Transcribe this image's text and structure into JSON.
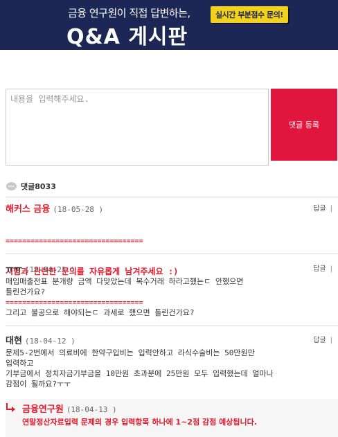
{
  "banner": {
    "subtitle": "금융 연구원이 직접 답변하는,",
    "title": "Q&A 게시판",
    "badge": "실시간 부분점수 문의!"
  },
  "form": {
    "placeholder": "내용을 입력해주세요.",
    "submit_label": "댓글 등록"
  },
  "comment_count_label": "댓글8033",
  "reply_label": "답글",
  "reply_separator": "|",
  "comments": [
    {
      "author": "해커스 금융",
      "date": "(18-05-28 )",
      "lines": [
        "=================================",
        "시험과 관련한 문의를 자유롭게 남겨주세요 :)",
        "================================="
      ]
    },
    {
      "author": "ㅠㅠ",
      "date": "(18-04-21 )",
      "body": "매입매출전표 분개량 금액 다맞았는데 복수거래 하라고했는ㄷ 안했으면\n틀린건가요?\n\n그리고 불공으로 해야되는ㄷ 과세로 했으면 틀린건가요?"
    },
    {
      "author": "대현",
      "date": "(18-04-12 )",
      "body": "문제5-2번에서 의료비에 한약구입비는 입력안하고 라식수술비는 50만원만\n입력하고\n기부금에서 정치자금기부금을 10만원 초과분에 25만원 모두 입력했는데 얼마나\n감점이 될까요?ㅜㅜ"
    }
  ],
  "answer": {
    "author": "금융연구원",
    "date": "(18-04-13 )",
    "body": "연말정산자료입력 문제의 경우 입력항목 하나에 1~2점 감점 예상됩니다."
  },
  "colors": {
    "banner_bg": "#1d2756",
    "accent_red": "#e31b2d",
    "button_red": "#e0163e",
    "badge_yellow": "#f5d21a"
  }
}
